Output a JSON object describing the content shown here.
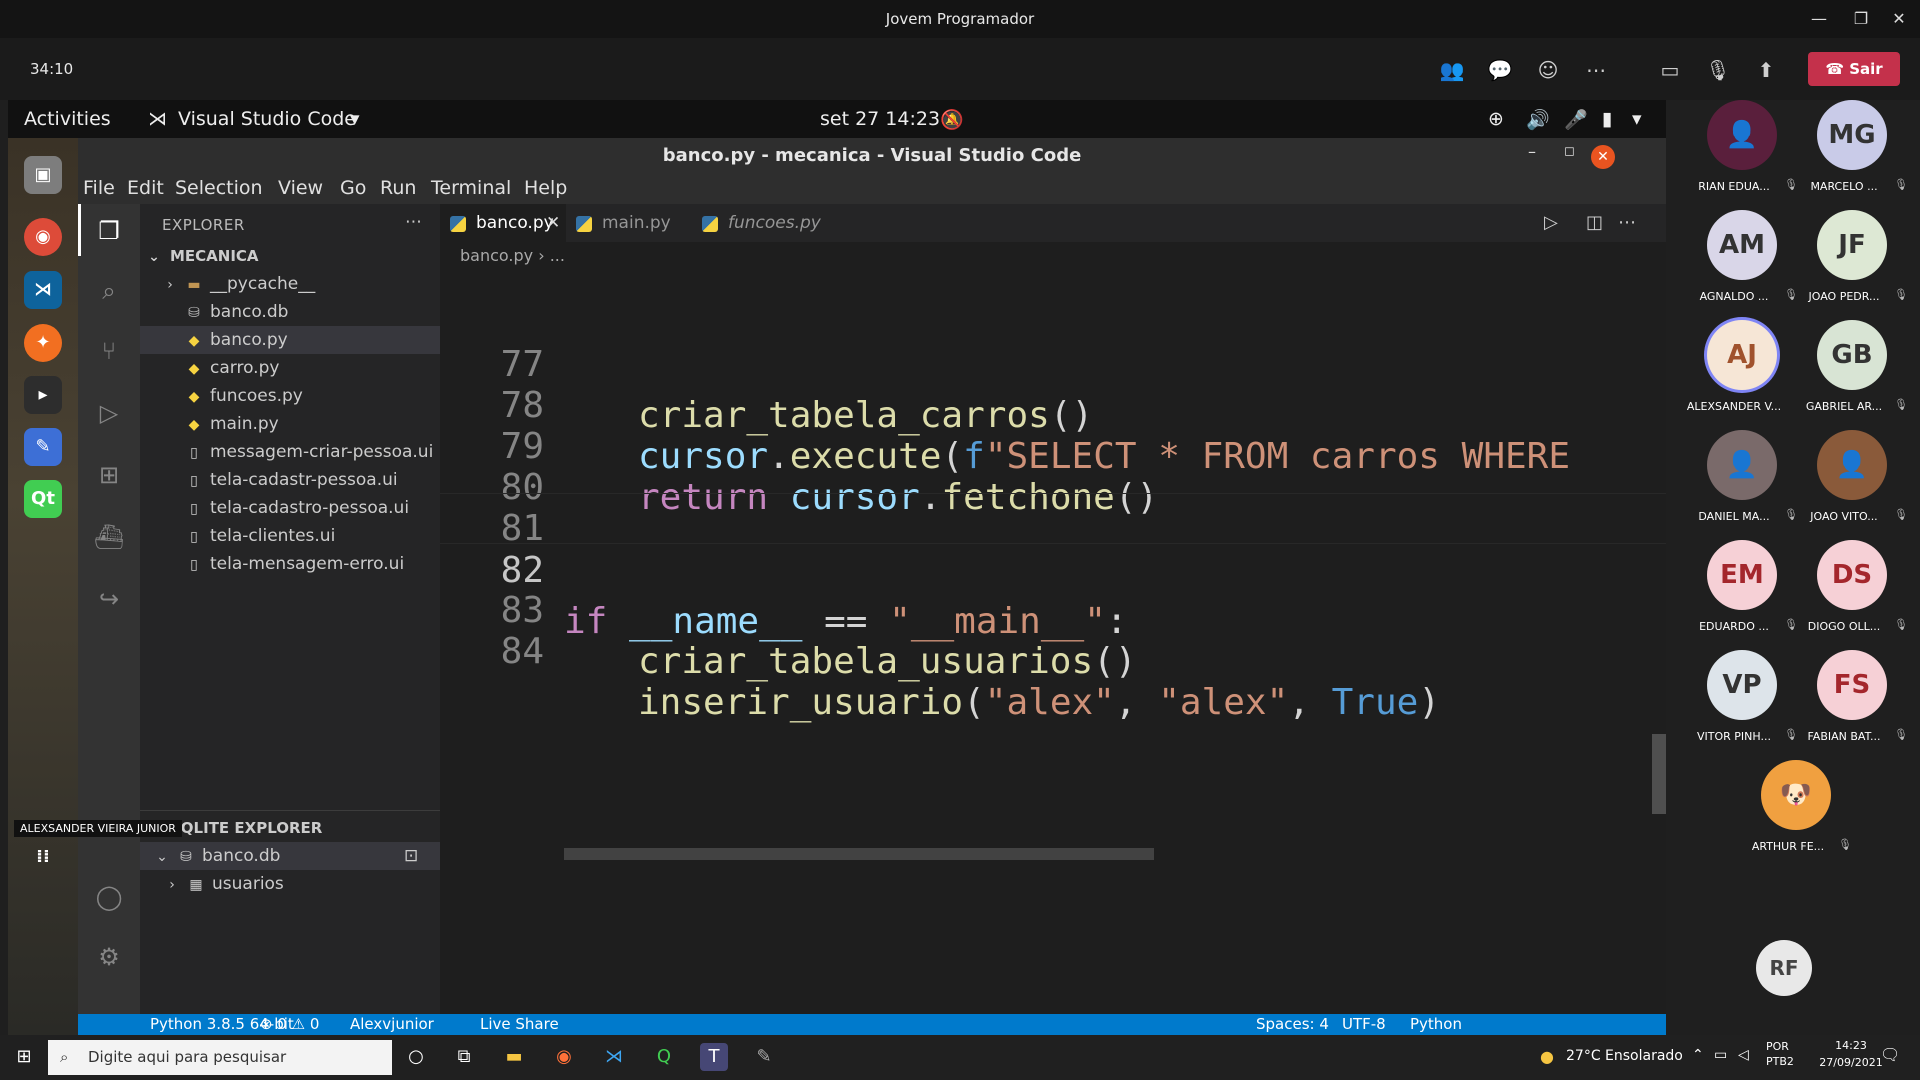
{
  "teams": {
    "title": "Jovem Programador",
    "timer": "34:10",
    "leave_label": "Sair",
    "presenter_label": "ALEXSANDER VIEIRA JUNIOR"
  },
  "gnome": {
    "activities": "Activities",
    "app_name": "Visual Studio Code",
    "datetime": "set 27  14:23"
  },
  "vscode": {
    "window_title": "banco.py - mecanica - Visual Studio Code",
    "menu": [
      "File",
      "Edit",
      "Selection",
      "View",
      "Go",
      "Run",
      "Terminal",
      "Help"
    ],
    "explorer_header": "EXPLORER",
    "folder": "MECANICA",
    "files": [
      "__pycache__",
      "banco.db",
      "banco.py",
      "carro.py",
      "funcoes.py",
      "main.py",
      "messagem-criar-pessoa.ui",
      "tela-cadastr-pessoa.ui",
      "tela-cadastro-pessoa.ui",
      "tela-clientes.ui",
      "tela-mensagem-erro.ui"
    ],
    "sqlite_header": "SQLITE EXPLORER",
    "sqlite_db": "banco.db",
    "sqlite_table": "usuarios",
    "tabs": [
      "banco.py",
      "main.py",
      "funcoes.py"
    ],
    "breadcrumb": "banco.py  ›  ...",
    "lines": {
      "l77": "77",
      "l78": "78",
      "l79": "79",
      "l80": "80",
      "l81": "81",
      "l82": "82",
      "l83": "83",
      "l84": "84"
    },
    "status": {
      "python": "Python 3.8.5 64-bit",
      "problems": "⊗ 0 ⚠ 0",
      "user": "Alexvjunior",
      "liveshare": "Live Share",
      "spaces": "Spaces: 4",
      "encoding": "UTF-8",
      "language": "Python"
    }
  },
  "participants": [
    {
      "initials": "",
      "name": "RIAN EDUA...",
      "color": "#5a1f3c"
    },
    {
      "initials": "MG",
      "name": "MARCELO ...",
      "color": "#c9cbe8"
    },
    {
      "initials": "AM",
      "name": "AGNALDO ...",
      "color": "#d9d6e8"
    },
    {
      "initials": "JF",
      "name": "JOAO PEDR...",
      "color": "#dde8d4"
    },
    {
      "initials": "AJ",
      "name": "ALEXSANDER V...",
      "color": "#f6e6d6"
    },
    {
      "initials": "GB",
      "name": "GABRIEL AR...",
      "color": "#d8e4d4"
    },
    {
      "initials": "",
      "name": "DANIEL MA...",
      "color": "#7a6a6a"
    },
    {
      "initials": "",
      "name": "JOAO VITO...",
      "color": "#8a5a3a"
    },
    {
      "initials": "EM",
      "name": "EDUARDO ...",
      "color": "#f6d0d6"
    },
    {
      "initials": "DS",
      "name": "DIOGO OLL...",
      "color": "#f6d0d6"
    },
    {
      "initials": "VP",
      "name": "VITOR PINH...",
      "color": "#dde4ea"
    },
    {
      "initials": "FS",
      "name": "FABIAN BAT...",
      "color": "#f6d0d6"
    },
    {
      "initials": "",
      "name": "ARTHUR FE...",
      "color": "#f0a040"
    },
    {
      "initials": "RF",
      "name": "",
      "color": "#e8e8e8"
    }
  ],
  "taskbar": {
    "search_placeholder": "Digite aqui para pesquisar",
    "weather": "27°C  Ensolarado",
    "lang": "POR\nPTB2",
    "time": "14:23",
    "date": "27/09/2021"
  }
}
